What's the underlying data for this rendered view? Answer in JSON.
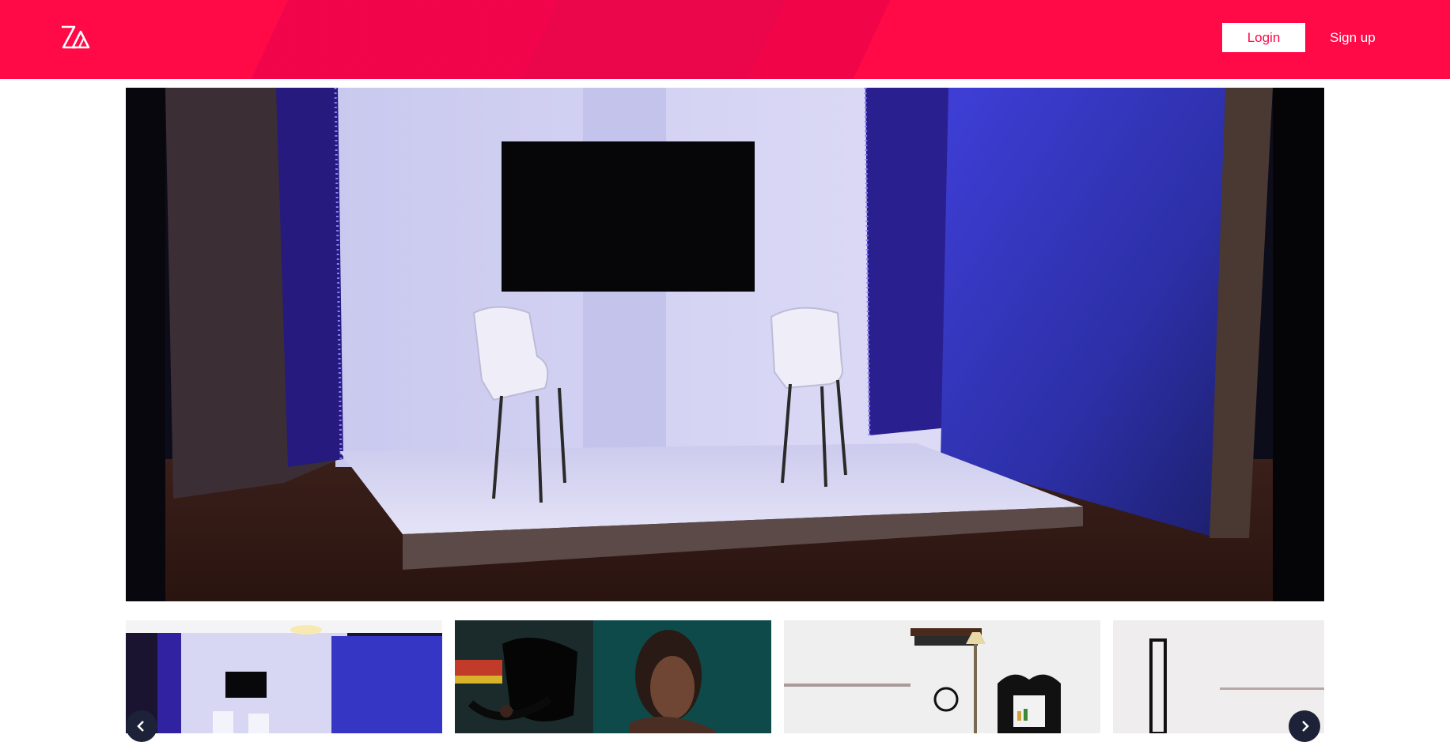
{
  "header": {
    "background_color": "#ff0a47",
    "logo_icon": "brand-logo-icon",
    "login_label": "Login",
    "signup_label": "Sign up"
  },
  "gallery": {
    "main_image": "studio-stage-with-two-white-chairs-and-tv",
    "thumbnails": [
      {
        "image": "studio-stage-with-chairs"
      },
      {
        "image": "portrait-with-umbrella-light"
      },
      {
        "image": "makeup-station"
      },
      {
        "image": "mirror-room"
      }
    ],
    "prev_icon": "chevron-left-icon",
    "next_icon": "chevron-right-icon"
  }
}
